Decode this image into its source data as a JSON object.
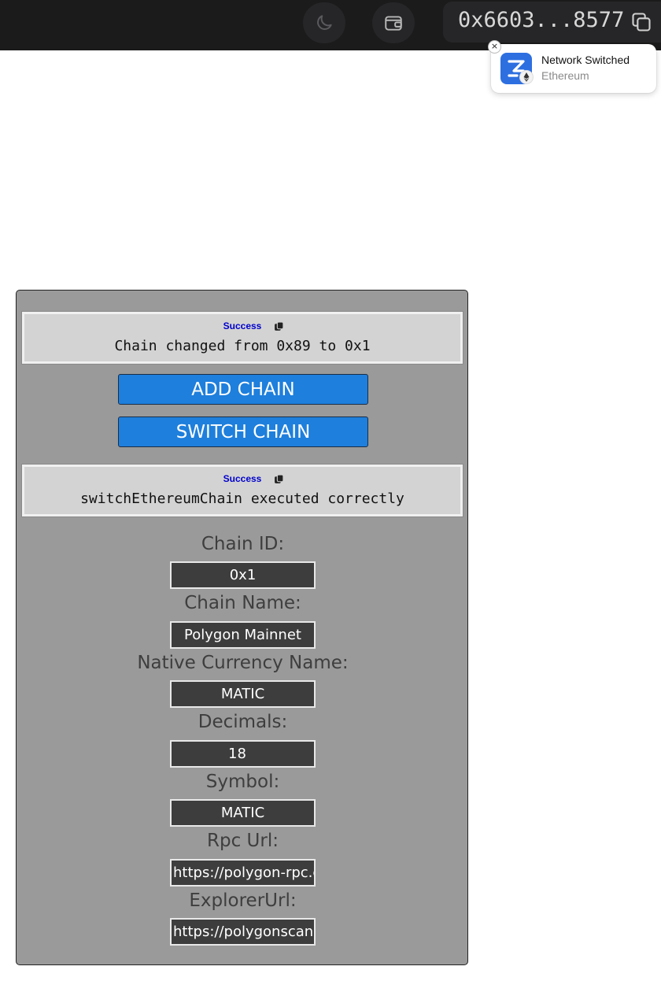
{
  "topbar": {
    "address": "0x6603...8577",
    "icons": [
      "moon-icon",
      "wallet-icon",
      "copy-icon"
    ]
  },
  "toast": {
    "title": "Network Switched",
    "subtitle": "Ethereum",
    "close": "×"
  },
  "panel": {
    "message_1": {
      "status": "Success",
      "text": "Chain changed from 0x89 to 0x1"
    },
    "add_chain_label": "ADD CHAIN",
    "switch_chain_label": "SWITCH CHAIN",
    "message_2": {
      "status": "Success",
      "text": "switchEthereumChain executed correctly"
    },
    "fields": {
      "chain_id": {
        "label": "Chain ID:",
        "value": "0x1"
      },
      "chain_name": {
        "label": "Chain Name:",
        "value": "Polygon Mainnet"
      },
      "native_currency": {
        "label": "Native Currency Name:",
        "value": "MATIC"
      },
      "decimals": {
        "label": "Decimals:",
        "value": "18"
      },
      "symbol": {
        "label": "Symbol:",
        "value": "MATIC"
      },
      "rpc_url": {
        "label": "Rpc Url:",
        "value": "https://polygon-rpc.com/"
      },
      "explorer_url": {
        "label": "ExplorerUrl:",
        "value": "https://polygonscan.com/"
      }
    }
  },
  "colors": {
    "topbar_bg": "#1b1b1c",
    "button_blue": "#1e7fdc",
    "status_blue": "#0000cc",
    "panel_bg": "#9a9a9a"
  }
}
